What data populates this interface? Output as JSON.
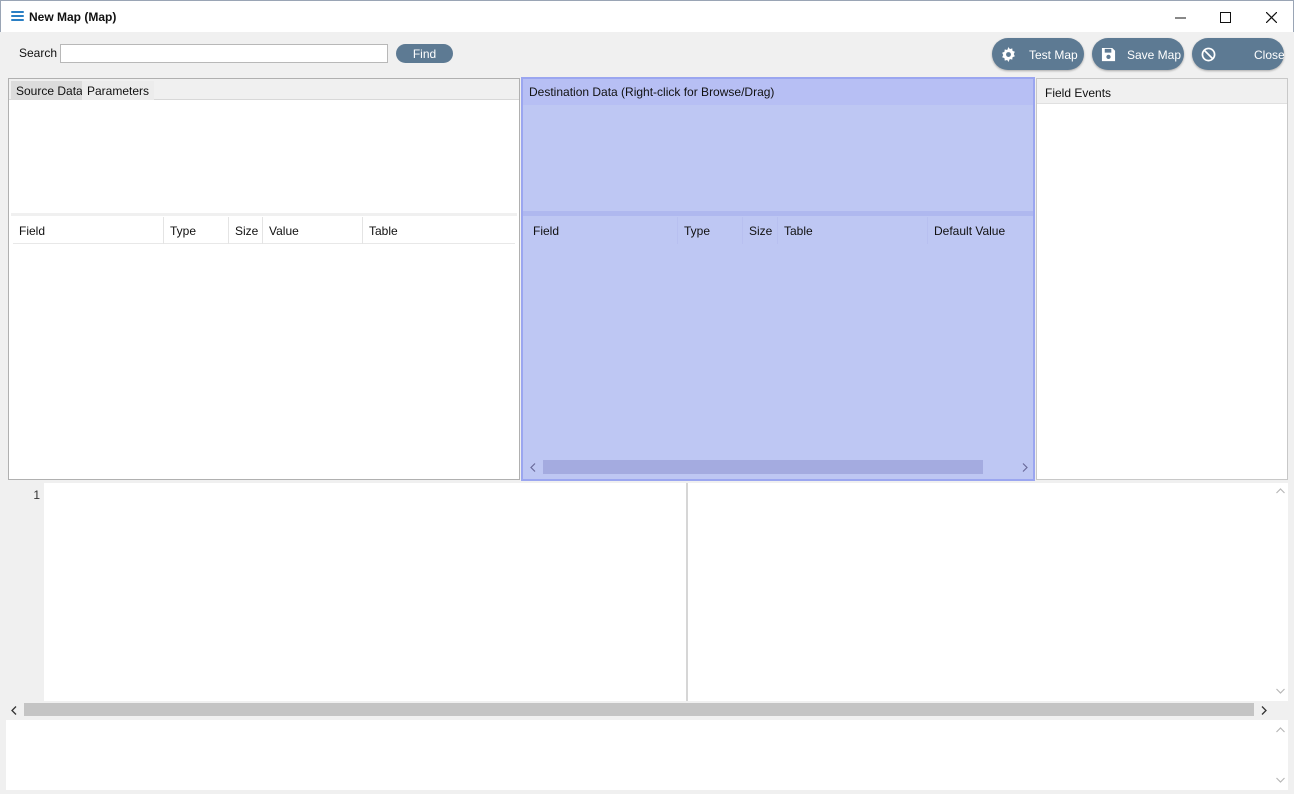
{
  "window": {
    "title": "New Map (Map)",
    "icon": "menu-lines-icon",
    "controls": [
      "minimize-icon",
      "maximize-icon",
      "close-icon"
    ]
  },
  "toolbar": {
    "search_label": "Search",
    "search_value": "",
    "find_label": "Find",
    "test_map_label": "Test Map",
    "save_map_label": "Save Map",
    "close_label": "Close"
  },
  "source": {
    "tabs": [
      "Source Data",
      "Parameters"
    ],
    "columns": [
      "Field",
      "Type",
      "Size",
      "Value",
      "Table"
    ]
  },
  "destination": {
    "title": "Destination Data   (Right-click for Browse/Drag)",
    "columns": [
      "Field",
      "Type",
      "Size",
      "Table",
      "Default Value"
    ]
  },
  "field_events": {
    "title": "Field Events"
  },
  "editor": {
    "line_number": "1"
  },
  "colors": {
    "button": "#5d7a93",
    "highlight": "#b7bff4"
  }
}
